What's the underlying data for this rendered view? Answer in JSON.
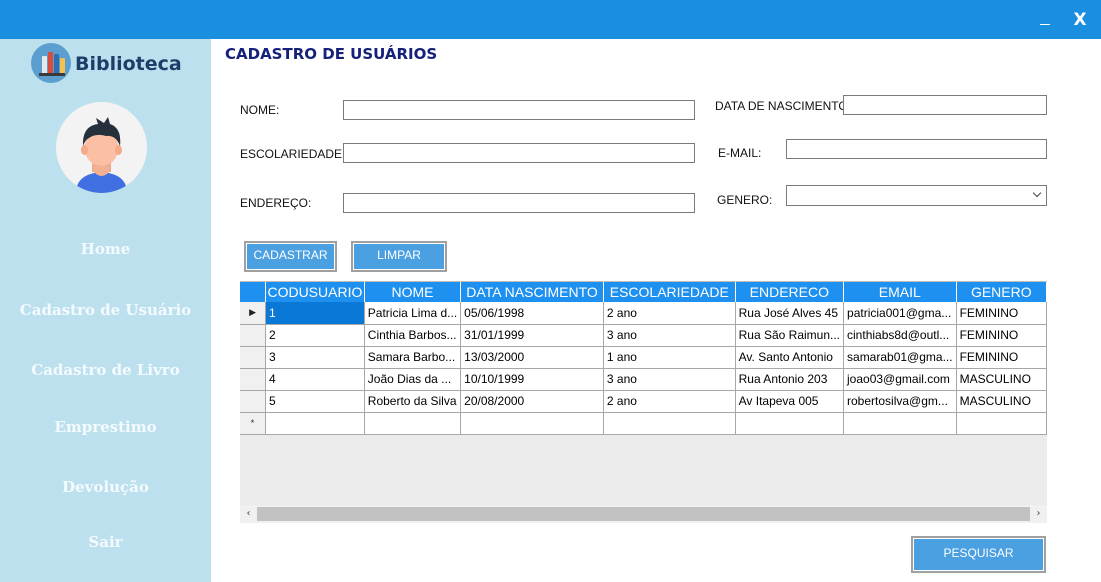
{
  "window": {
    "minimize_icon": "minimize-icon",
    "close_label": "X"
  },
  "sidebar": {
    "logo_text": "Biblioteca",
    "nav": [
      {
        "label": "Home"
      },
      {
        "label": "Cadastro de Usuário"
      },
      {
        "label": "Cadastro de Livro"
      },
      {
        "label": "Emprestimo"
      },
      {
        "label": "Devolução"
      },
      {
        "label": "Sair"
      }
    ]
  },
  "main": {
    "title": "CADASTRO DE USUÁRIOS",
    "form": {
      "nome_label": "NOME:",
      "nome_value": "",
      "nascimento_label": "DATA DE NASCIMENTO;",
      "nascimento_value": "",
      "escolaridade_label": "ESCOLARIEDADE:",
      "escolaridade_value": "",
      "email_label": "E-MAIL:",
      "email_value": "",
      "endereco_label": "ENDEREÇO:",
      "endereco_value": "",
      "genero_label": "GENERO:",
      "genero_value": ""
    },
    "buttons": {
      "cadastrar": "CADASTRAR",
      "limpar": "LIMPAR",
      "pesquisar": "PESQUISAR"
    },
    "grid": {
      "columns": [
        "CODUSUARIO",
        "NOME",
        "DATA NASCIMENTO",
        "ESCOLARIEDADE",
        "ENDERECO",
        "EMAIL",
        "GENERO"
      ],
      "rows": [
        [
          "1",
          "Patricia Lima d...",
          "05/06/1998",
          "2 ano",
          "Rua José Alves 45",
          "patricia001@gma...",
          "FEMININO"
        ],
        [
          "2",
          "Cinthia Barbos...",
          "31/01/1999",
          "3 ano",
          "Rua São Raimun...",
          "cinthiabs8d@outl...",
          "FEMININO"
        ],
        [
          "3",
          "Samara Barbo...",
          "13/03/2000",
          "1 ano",
          "Av. Santo Antonio",
          "samarab01@gma...",
          "FEMININO"
        ],
        [
          "4",
          "João Dias da ...",
          "10/10/1999",
          "3 ano",
          "Rua Antonio 203",
          "joao03@gmail.com",
          "MASCULINO"
        ],
        [
          "5",
          "Roberto da Silva",
          "20/08/2000",
          "2 ano",
          "Av Itapeva 005",
          "robertosilva@gm...",
          "MASCULINO"
        ]
      ],
      "current_row_marker": "▶",
      "new_row_marker": "*"
    }
  },
  "colors": {
    "titlebar": "#1a8fdf",
    "sidebar": "#bde0ee",
    "accent": "#1e90ef",
    "button": "#4aa0e0",
    "title": "#14207a"
  }
}
